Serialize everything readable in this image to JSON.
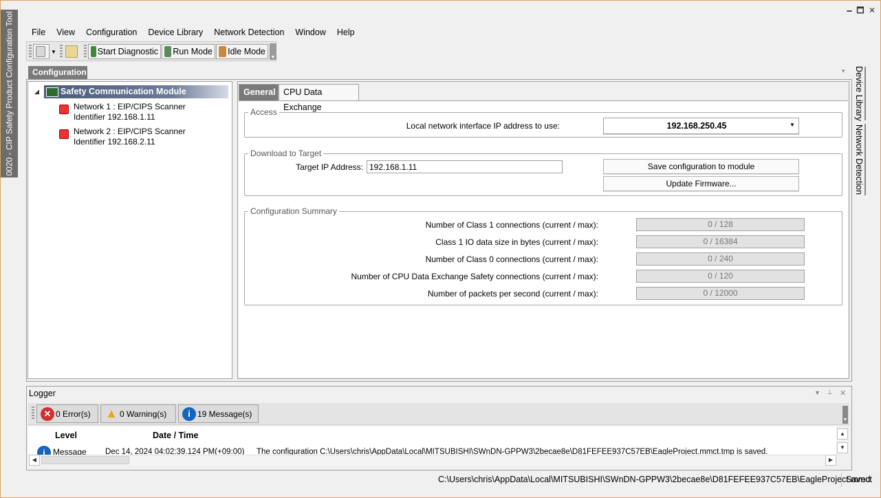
{
  "app": {
    "vertical_title": "0020 - CIP Safety Product Configuration Tool"
  },
  "window_controls": {
    "minimize": "🗕",
    "maximize": "🗖",
    "close": "✕"
  },
  "menu": [
    "File",
    "View",
    "Configuration",
    "Device Library",
    "Network Detection",
    "Window",
    "Help"
  ],
  "toolbar": {
    "start_diagnostic": "Start Diagnostic",
    "run_mode": "Run Mode",
    "idle_mode": "Idle Mode"
  },
  "configuration_tab": "Configuration",
  "tree": {
    "root": "Safety Communication Module",
    "items": [
      {
        "line1": "Network 1 : EIP/CIPS Scanner",
        "line2": "Identifier 192.168.1.11"
      },
      {
        "line1": "Network 2 : EIP/CIPS Scanner",
        "line2": "Identifier 192.168.2.11"
      }
    ]
  },
  "tabs": {
    "general": "General",
    "cpu": "CPU Data Exchange"
  },
  "access": {
    "title": "Access",
    "label": "Local network interface IP address to use:",
    "value": "192.168.250.45"
  },
  "download": {
    "title": "Download to Target",
    "label": "Target IP Address:",
    "value": "192.168.1.11",
    "save_button": "Save configuration to module",
    "update_button": "Update Firmware..."
  },
  "summary": {
    "title": "Configuration Summary",
    "rows": [
      {
        "label": "Number of Class 1 connections (current / max):",
        "value": "0 / 128"
      },
      {
        "label": "Class 1 IO data size in bytes (current / max):",
        "value": "0 / 16384"
      },
      {
        "label": "Number of Class 0 connections (current / max):",
        "value": "0 / 240"
      },
      {
        "label": "Number of CPU Data Exchange Safety connections (current / max):",
        "value": "0 / 120"
      },
      {
        "label": "Number of packets per second (current / max):",
        "value": "0 / 12000"
      }
    ]
  },
  "right_tabs": {
    "device_library": "Device Library",
    "network_detection": "Network Detection"
  },
  "logger": {
    "title": "Logger",
    "errors": "0 Error(s)",
    "warnings": "0 Warning(s)",
    "messages": "19 Message(s)",
    "col_level": "Level",
    "col_datetime": "Date / Time",
    "row": {
      "level": "Message",
      "datetime": "Dec 14, 2024 04:02:39.124 PM(+09:00)",
      "text": "The configuration C:\\Users\\chris\\AppData\\Local\\MITSUBISHI\\SWnDN-GPPW3\\2becae8e\\D81FEFEE937C57EB\\EagleProject.mmct.tmp is saved."
    }
  },
  "status": {
    "path": "C:\\Users\\chris\\AppData\\Local\\MITSUBISHI\\SWnDN-GPPW3\\2becae8e\\D81FEFEE937C57EB\\EagleProject.mmct",
    "state": "Saved"
  },
  "colors": {
    "accent_gray": "#7a7a7a",
    "tree_selection": "#4a5a7a",
    "error": "#d32f2f",
    "warning": "#f0a020",
    "info": "#1565c0"
  }
}
